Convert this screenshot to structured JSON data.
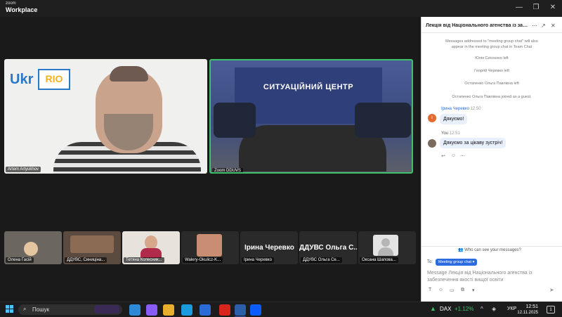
{
  "window": {
    "brand_small": "zoom",
    "brand_big": "Workplace"
  },
  "tiles": {
    "main_left_name": "Artem Artyukhov",
    "main_right_name": "Zoom DDUVS",
    "banner_text": "СИТУАЦІЙНИЙ ЦЕНТР",
    "logo_ukr": "Ukr",
    "logo_rio": "RIO"
  },
  "thumbnails": [
    {
      "name": "Олена Гасій"
    },
    {
      "name": "ДДУВС, Синиціна..."
    },
    {
      "name": "Тетяна Колесник..."
    },
    {
      "name": "Walery-Okulicz-K..."
    },
    {
      "name": "Ірина Черевко",
      "title": "Ірина Черевко"
    },
    {
      "name": "ДДУВС Ольга Се...",
      "title": "ДДУВС Ольга С..."
    },
    {
      "name": "Оксана Шапова..."
    }
  ],
  "chat": {
    "title": "Лекція від Національного агенства із забез...",
    "system_messages": [
      "Messages addressed to \"meeting group chat\" will also",
      "appear in the meeting group chat in Team Chat",
      "Юлія Сисоєнко left",
      "Георгій Черевко left",
      "Остапенко Ольга Павлівна left",
      "Остапенко Ольга Павлівна joined as a guest."
    ],
    "msg1": {
      "sender": "Ірина Черевко",
      "time": "12:50",
      "text": "Дякуємо!"
    },
    "msg2": {
      "sender": "You",
      "time": "12:51",
      "text": "Дякуємо за цікаву зустріч!"
    },
    "who_can_see": "Who can see your messages?",
    "to_label": "To:",
    "to_chip": "Meeting group chat",
    "composer_placeholder": "Message Лекція від Національного агенства із забезпечення якості вищої освіти"
  },
  "taskbar": {
    "search_label": "Пошук",
    "stock_name": "DAX",
    "stock_change": "+1.12%",
    "language": "УКР",
    "time": "12:51",
    "date": "12.11.2025",
    "notifications": "1"
  },
  "colors": {
    "accent": "#2d6be0",
    "active_speaker": "#3fc06a",
    "stock_up": "#3fc06a"
  }
}
